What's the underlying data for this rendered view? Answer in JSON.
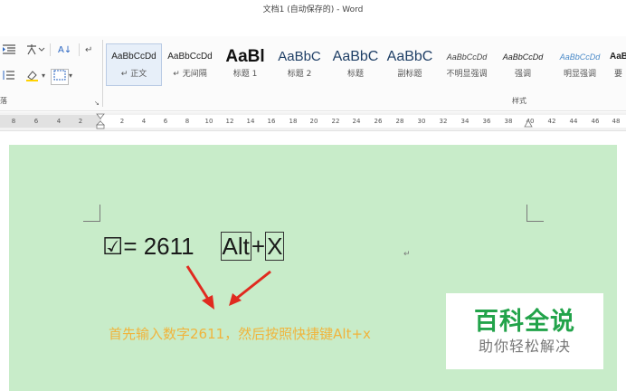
{
  "window": {
    "title": "文档1 (自动保存的) - Word"
  },
  "ribbon": {
    "paragraph_tools": {
      "sort_label": "A↓",
      "pilcrow": "↵",
      "shading_dropdown": "▾",
      "border_dropdown": "▾"
    },
    "group_labels": {
      "paragraph_fragment": "落",
      "styles": "样式"
    },
    "styles": [
      {
        "sample": "AaBbCcDd",
        "name": "↵ 正文",
        "selected": true
      },
      {
        "sample": "AaBbCcDd",
        "name": "↵ 无间隔",
        "selected": false
      },
      {
        "sample": "AaBl",
        "name": "标题 1",
        "selected": false
      },
      {
        "sample": "AaBbC",
        "name": "标题 2",
        "selected": false
      },
      {
        "sample": "AaBbC",
        "name": "标题",
        "selected": false
      },
      {
        "sample": "AaBbC",
        "name": "副标题",
        "selected": false
      },
      {
        "sample": "AaBbCcDd",
        "name": "不明显强调",
        "selected": false
      },
      {
        "sample": "AaBbCcDd",
        "name": "强调",
        "selected": false
      },
      {
        "sample": "AaBbCcDd",
        "name": "明显强调",
        "selected": false
      },
      {
        "sample": "AaB",
        "name": "要",
        "selected": false
      }
    ]
  },
  "ruler": {
    "ticks": [
      "8",
      "6",
      "4",
      "2",
      "2",
      "4",
      "6",
      "8",
      "10",
      "12",
      "14",
      "16",
      "18",
      "20",
      "22",
      "24",
      "26",
      "28",
      "30",
      "32",
      "34",
      "36",
      "38",
      "40",
      "42",
      "44",
      "46",
      "48"
    ]
  },
  "document": {
    "checkbox_symbol": "☑",
    "equals_text": "= 2611",
    "key_alt": "Alt",
    "plus": "+",
    "key_x": "X",
    "paragraph_mark": "↵",
    "instruction": "首先输入数字2611，然后按照快捷键Alt+x"
  },
  "watermark": {
    "title": "百科全说",
    "subtitle": "助你轻松解决"
  },
  "colors": {
    "page_background": "#c8ecc9",
    "instruction_text": "#f0b43c",
    "watermark_green": "#22a34a",
    "arrow_red": "#e02a1f"
  }
}
